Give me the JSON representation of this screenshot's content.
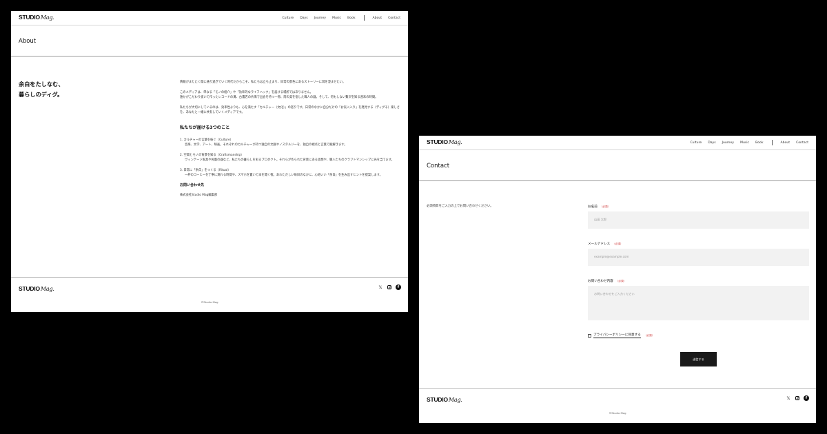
{
  "site": {
    "logo_bold": "STUDIO",
    "logo_script": "Mag.",
    "nav": [
      "Culture",
      "Days",
      "Journey",
      "Music",
      "Book"
    ],
    "nav_secondary": [
      "About",
      "Contact"
    ],
    "copyright": "©Studio Mag"
  },
  "about": {
    "title": "About",
    "tagline": [
      "余白をたしなむ、",
      "暮らしのディグ。"
    ],
    "p1": "情報がまたたく間に通り過ぎていく時代だからこそ、私たちは立ち止まり、日常の景色にあるストーリーに耳を澄ませたい。",
    "p2a": "このメディアは、単なる「モノの紹介」や「効率的なライフハック」を届ける場所ではありません。",
    "p2b": "誰かがこだわり抜いて作ったレコードの溝、古書店の片隅で出会を待つ一冊、南の美を宿した職人の器。そして、何もしない贅沢を知る週末の時間。",
    "p3": "私たちが大切にしているのは、効率性よりも、心を満たす「カルチャー（文化）」の巡りです。日常のなかに自分だけの「お気に入り」を発見する（ディグる）楽しさを、あなたと一緒に共有していくメディアです。",
    "heading": "私たちが届ける3つのこと",
    "items": [
      {
        "title": "1. カルチャーの言葉を紡ぐ（Culture）",
        "desc": "音楽、文学、アート、映画。それぞれのカルチャーが持つ独自の文脈やノスタルジーを、独自の視点と言葉で掘解きます。"
      },
      {
        "title": "2. 空間とモノの背景を知る（Craftsmanship）",
        "desc": "ヴィンテージ家具や民藝の器など、私たちの暮らしを彩るプロダクト。それらが作られた背景にある思想や、職人たちのクラフトマンシップに光を当てます。"
      },
      {
        "title": "3. 日常に「余白」をつくる（Ritual）",
        "desc": "一杯のコーヒーを丁寧に淹れる時間や、スマホを置いて本を開く夜。あわただしい毎日のなかに、心地いい「余白」を生み出すヒントを提案します。"
      }
    ],
    "contact_heading": "お問い合わせ先",
    "contact_name": "株式会社Studio Mag編集部"
  },
  "contact": {
    "title": "Contact",
    "intro": "必須項目をご入力の上でお問い合わせください。",
    "required": "（必須）",
    "name_label": "お名前",
    "name_placeholder": "山田 太郎",
    "email_label": "メールアドレス",
    "email_placeholder": "example@example.com",
    "message_label": "お問い合わせ内容",
    "message_placeholder": "お問い合わせをご入力ください",
    "agree_label": "プライバシーポリシーに同意する",
    "submit": "送信する"
  },
  "icons": [
    "x-icon",
    "instagram-icon",
    "facebook-icon"
  ]
}
